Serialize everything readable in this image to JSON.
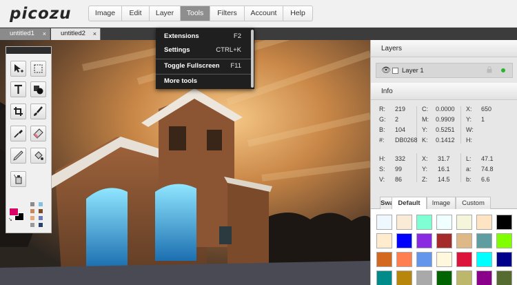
{
  "app": {
    "logo": "picozu"
  },
  "menu": [
    "Image",
    "Edit",
    "Layer",
    "Tools",
    "Filters",
    "Account",
    "Help"
  ],
  "menu_active": "Tools",
  "doc_tabs": [
    {
      "label": "untitled1",
      "close": "×",
      "active": true
    },
    {
      "label": "untitled2",
      "close": "×",
      "active": false
    }
  ],
  "tools_menu": [
    {
      "label": "Extensions",
      "shortcut": "F2"
    },
    {
      "label": "Settings",
      "shortcut": "CTRL+K"
    },
    {
      "label": "Toggle Fullscreen",
      "shortcut": "F11"
    },
    {
      "label": "More tools",
      "shortcut": ""
    }
  ],
  "tools": [
    "move-tool-icon",
    "marquee-select-icon",
    "text-tool-icon",
    "shape-tool-icon",
    "crop-tool-icon",
    "brush-tool-icon",
    "eyedropper-icon",
    "eraser-icon",
    "pencil-icon",
    "fill-bucket-icon",
    "spray-can-icon"
  ],
  "colors": {
    "foreground": "#DB0268",
    "background": "#000000",
    "mini_palette": [
      "#8b8b8b",
      "#7fc3e0",
      "#c8865a",
      "#7a4a2a",
      "#e8a878",
      "#6a7ab8",
      "#9a9a9a",
      "#24446a"
    ]
  },
  "layers": {
    "title": "Layers",
    "items": [
      {
        "name": "Layer 1",
        "visible_icon": "eye-icon",
        "status_color": "#2bb32b"
      }
    ]
  },
  "info": {
    "title": "Info",
    "rgb": [
      {
        "k": "R:",
        "v": "219"
      },
      {
        "k": "G:",
        "v": "2"
      },
      {
        "k": "B:",
        "v": "104"
      },
      {
        "k": "#:",
        "v": "DB0268"
      }
    ],
    "cmyk": [
      {
        "k": "C:",
        "v": "0.0000"
      },
      {
        "k": "M:",
        "v": "0.9909"
      },
      {
        "k": "Y:",
        "v": "0.5251"
      },
      {
        "k": "K:",
        "v": "0.1412"
      }
    ],
    "pos": [
      {
        "k": "X:",
        "v": "650"
      },
      {
        "k": "Y:",
        "v": "1"
      },
      {
        "k": "W:",
        "v": ""
      },
      {
        "k": "H:",
        "v": ""
      }
    ],
    "hsv": [
      {
        "k": "H:",
        "v": "332"
      },
      {
        "k": "S:",
        "v": "99"
      },
      {
        "k": "V:",
        "v": "86"
      }
    ],
    "xyz": [
      {
        "k": "X:",
        "v": "31.7"
      },
      {
        "k": "Y:",
        "v": "16.1"
      },
      {
        "k": "Z:",
        "v": "14.5"
      }
    ],
    "lab": [
      {
        "k": "L:",
        "v": "47.1"
      },
      {
        "k": "a:",
        "v": "74.8"
      },
      {
        "k": "b:",
        "v": "6.6"
      }
    ]
  },
  "swatches": {
    "tabs": [
      "Swa",
      "Default",
      "Image",
      "Custom"
    ],
    "active_tab": "Default",
    "colors": [
      "#f0f8ff",
      "#faebd7",
      "#7fffd4",
      "#f0ffff",
      "#f5f5dc",
      "#ffe4c4",
      "#000000",
      "#ffebcd",
      "#0000ff",
      "#8a2be2",
      "#a52a2a",
      "#deb887",
      "#5f9ea0",
      "#7fff00",
      "#d2691e",
      "#ff7f50",
      "#6495ed",
      "#fff8dc",
      "#dc143c",
      "#00ffff",
      "#00008b",
      "#008b8b",
      "#b8860b",
      "#a9a9a9",
      "#006400",
      "#bdb76b",
      "#8b008b",
      "#556b2f"
    ]
  }
}
